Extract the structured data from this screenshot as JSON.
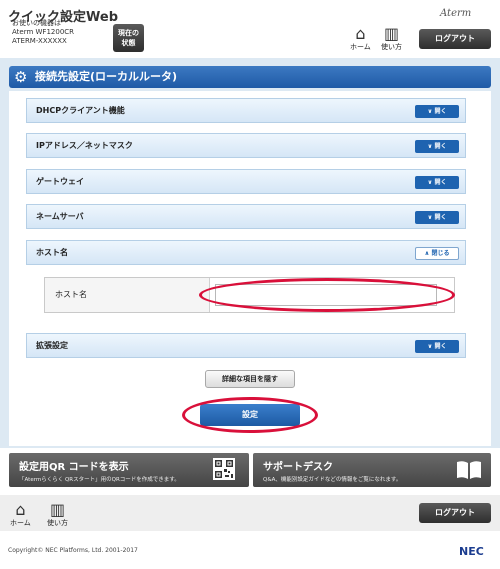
{
  "header": {
    "app_title": "クイック設定Web",
    "device_line1": "お使いの機器は",
    "device_line2": "Aterm WF1200CR",
    "device_line3": "ATERM-XXXXXX",
    "status_button_line1": "現在の",
    "status_button_line2": "状態",
    "brand": "Aterm",
    "home_label": "ホーム",
    "help_label": "使い方",
    "logout_label": "ログアウト"
  },
  "section": {
    "title": "接続先設定(ローカルルータ)"
  },
  "accordions": [
    {
      "label": "DHCPクライアント機能",
      "button": "開く"
    },
    {
      "label": "IPアドレス／ネットマスク",
      "button": "開く"
    },
    {
      "label": "ゲートウェイ",
      "button": "開く"
    },
    {
      "label": "ネームサーバ",
      "button": "開く"
    },
    {
      "label": "ホスト名",
      "button": "閉じる"
    },
    {
      "label": "拡張設定",
      "button": "開く"
    }
  ],
  "host_field": {
    "label": "ホスト名",
    "value": ""
  },
  "buttons": {
    "detail_toggle": "詳細な項目を隠す",
    "submit": "設定"
  },
  "cards": {
    "qr": {
      "title": "設定用QR コードを表示",
      "subtitle": "「Atermらくらく QRスタート」用のQRコードを作成できます。"
    },
    "support": {
      "title": "サポートデスク",
      "subtitle": "Q&A、機能別設定ガイドなどの情報をご覧になれます。"
    }
  },
  "footer": {
    "home_label": "ホーム",
    "help_label": "使い方",
    "logout_label": "ログアウト",
    "copyright": "Copyright© NEC Platforms, Ltd. 2001-2017",
    "logo": "NEC"
  },
  "colors": {
    "accent_blue": "#1e63b0",
    "highlight_red": "#d9103a",
    "content_bg": "#dde9f3"
  }
}
